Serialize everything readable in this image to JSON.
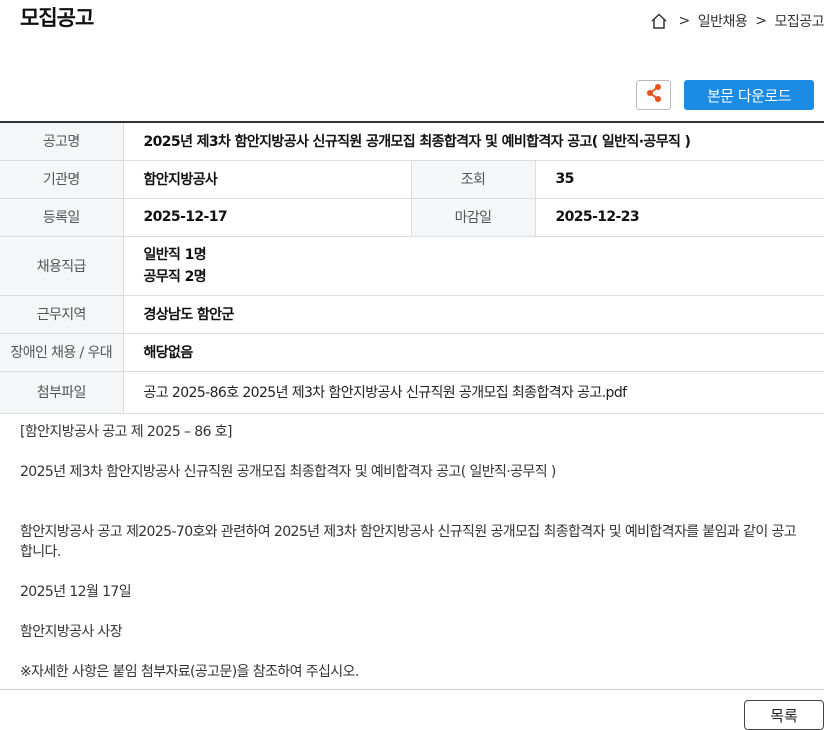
{
  "header": {
    "title": "모집공고",
    "breadcrumb": {
      "home_icon": "home-icon",
      "sep1": ">",
      "item1": "일반채용",
      "sep2": ">",
      "item2": "모집공고"
    }
  },
  "toolbar": {
    "share_icon": "share-icon",
    "download_label": "본문 다운로드"
  },
  "info": {
    "title_label": "공고명",
    "title_value": "2025년 제3차 함안지방공사 신규직원 공개모집 최종합격자 및 예비합격자 공고( 일반직·공무직 )",
    "org_label": "기관명",
    "org_value": "함안지방공사",
    "views_label": "조회",
    "views_value": "35",
    "reg_label": "등록일",
    "reg_value": "2025-12-17",
    "deadline_label": "마감일",
    "deadline_value": "2025-12-23",
    "positions_label": "채용직급",
    "positions": [
      "일반직 1명",
      "공무직 2명"
    ],
    "region_label": "근무지역",
    "region_value": "경상남도 함안군",
    "disability_label": "장애인 채용 / 우대",
    "disability_value": "해당없음",
    "attachment_label": "첨부파일",
    "attachment_value": "공고 2025-86호 2025년 제3차 함안지방공사 신규직원 공개모집 최종합격자 공고.pdf"
  },
  "body": {
    "line1": "[함안지방공사 공고 제 2025 – 86 호]",
    "line2": "2025년 제3차 함안지방공사 신규직원 공개모집 최종합격자 및 예비합격자 공고( 일반직·공무직 )",
    "line3": "함안지방공사 공고 제2025-70호와 관련하여 2025년 제3차 함안지방공사 신규직원 공개모집 최종합격자 및 예비합격자를 붙임과 같이 공고합니다.",
    "line4": "2025년 12월 17일",
    "line5": "함안지방공사 사장",
    "line6": "※자세한 사항은 붙임 첨부자료(공고문)을 참조하여 주십시오."
  },
  "footer": {
    "list_label": "목록"
  }
}
